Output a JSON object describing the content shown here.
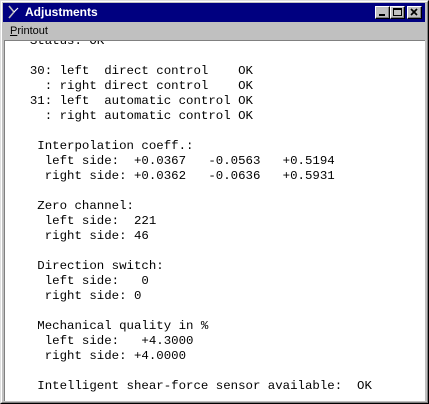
{
  "window": {
    "title": "Adjustments",
    "icon": "app-logo-icon",
    "buttons": [
      "minimize-icon",
      "maximize-icon",
      "close-icon"
    ]
  },
  "menu": {
    "items": [
      {
        "first": "P",
        "rest": "rintout"
      }
    ]
  },
  "report": {
    "lines": [
      "  Status: OK",
      "",
      "  30: left  direct control    OK",
      "    : right direct control    OK",
      "  31: left  automatic control OK",
      "    : right automatic control OK",
      "",
      "   Interpolation coeff.:",
      "    left side:  +0.0367   -0.0563   +0.5194",
      "    right side: +0.0362   -0.0636   +0.5931",
      "",
      "   Zero channel:",
      "    left side:  221",
      "    right side: 46",
      "",
      "   Direction switch:",
      "    left side:   0",
      "    right side: 0",
      "",
      "   Mechanical quality in %",
      "    left side:   +4.3000",
      "    right side: +4.0000",
      "",
      "   Intelligent shear-force sensor available:  OK"
    ]
  }
}
